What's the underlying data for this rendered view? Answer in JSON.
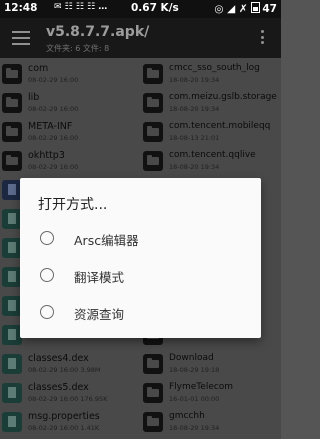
{
  "status_bar": {
    "time": "12:48",
    "icons": "✉ ☷ ☷ ☷ …",
    "speed": "0.67 K/s",
    "right_icons": "◎ ◢ ✗",
    "battery": "47"
  },
  "app_bar": {
    "title": "v5.8.7.7.apk/",
    "subtitle": "文件夹: 6 文件: 8"
  },
  "left_files": [
    {
      "name": "com",
      "meta": "08-02-29 16:00",
      "kind": "folder"
    },
    {
      "name": "lib",
      "meta": "08-02-29 16:00",
      "kind": "folder"
    },
    {
      "name": "META-INF",
      "meta": "08-02-29 16:00",
      "kind": "folder"
    },
    {
      "name": "okhttp3",
      "meta": "08-02-29 16:00",
      "kind": "folder"
    },
    {
      "name": "",
      "meta": "",
      "kind": "blue"
    },
    {
      "name": "",
      "meta": "",
      "kind": "file"
    },
    {
      "name": "",
      "meta": "",
      "kind": "file"
    },
    {
      "name": "",
      "meta": "",
      "kind": "file"
    },
    {
      "name": "",
      "meta": "",
      "kind": "file"
    },
    {
      "name": "",
      "meta": "",
      "kind": "file"
    },
    {
      "name": "classes4.dex",
      "meta": "08-02-29 16:00 3.98M",
      "kind": "file"
    },
    {
      "name": "classes5.dex",
      "meta": "08-02-29 16:00 176.95K",
      "kind": "file"
    },
    {
      "name": "msg.properties",
      "meta": "08-02-29 16:00 1.41K",
      "kind": "file"
    }
  ],
  "right_files": [
    {
      "name": "cmcc_sso_south_log",
      "meta": "18-08-20 19:34",
      "kind": "folder"
    },
    {
      "name": "com.meizu.gslb.storage",
      "meta": "18-08-20 19:34",
      "kind": "folder"
    },
    {
      "name": "com.tencent.mobileqq",
      "meta": "18-08-13 21:01",
      "kind": "folder"
    },
    {
      "name": "com.tencent.qqlive",
      "meta": "18-08-20 19:34",
      "kind": "folder"
    },
    {
      "name": "",
      "meta": "",
      "kind": "folder"
    },
    {
      "name": "",
      "meta": "",
      "kind": "folder"
    },
    {
      "name": "",
      "meta": "",
      "kind": "folder"
    },
    {
      "name": "",
      "meta": "",
      "kind": "folder"
    },
    {
      "name": "",
      "meta": "",
      "kind": "folder"
    },
    {
      "name": "",
      "meta": "",
      "kind": "folder"
    },
    {
      "name": "Download",
      "meta": "18-08-29 19:18",
      "kind": "folder"
    },
    {
      "name": "FlymeTelecom",
      "meta": "16-01-01 00:00",
      "kind": "folder"
    },
    {
      "name": "gmcchh",
      "meta": "18-08-20 19:34",
      "kind": "folder"
    }
  ],
  "dialog": {
    "title": "打开方式...",
    "options": [
      {
        "label": "Arsc编辑器"
      },
      {
        "label": "翻译模式"
      },
      {
        "label": "资源查询"
      }
    ]
  }
}
